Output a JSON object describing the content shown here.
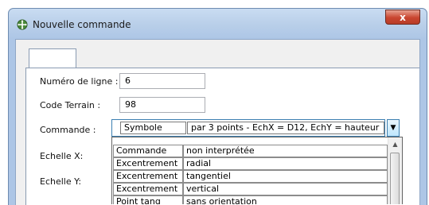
{
  "window": {
    "title": "Nouvelle commande",
    "close_glyph": "x",
    "icon": "move-cross-icon"
  },
  "fields": {
    "numero_label": "Numéro de ligne :",
    "numero_value": "6",
    "code_label": "Code Terrain :",
    "code_value": "98",
    "commande_label": "Commande :",
    "echelle_x_label": "Echelle X:",
    "echelle_y_label": "Echelle Y:"
  },
  "combo": {
    "col1": "Symbole",
    "col2": "par 3 points - EchX = D12, EchY = hauteur",
    "arrow": "▼"
  },
  "dropdown": {
    "rows": [
      {
        "col1": "Commande",
        "col2": "non interprétée"
      },
      {
        "col1": "Excentrement",
        "col2": "radial"
      },
      {
        "col1": "Excentrement",
        "col2": "tangentiel"
      },
      {
        "col1": "Excentrement",
        "col2": "vertical"
      },
      {
        "col1": "Point tang",
        "col2": "sans orientation"
      }
    ],
    "scroll_up": "▲"
  },
  "colors": {
    "titlebar": "#b9cfe9",
    "close_button": "#c9452f",
    "combo_border": "#3c7fb1"
  }
}
